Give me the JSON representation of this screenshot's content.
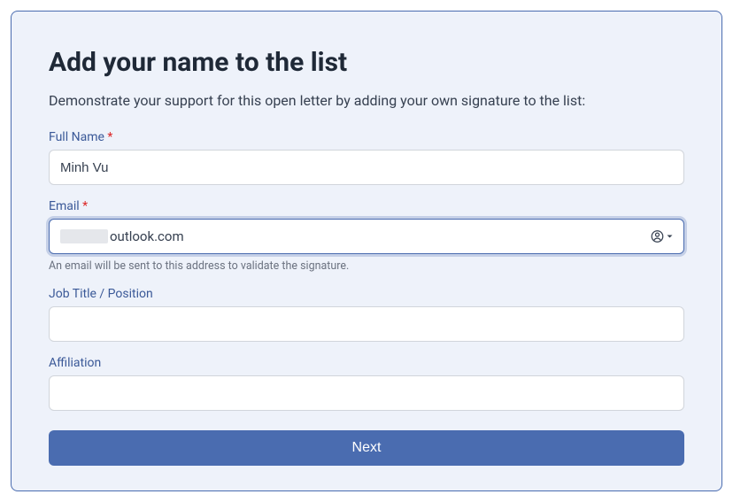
{
  "form": {
    "title": "Add your name to the list",
    "subtitle": "Demonstrate your support for this open letter by adding your own signature to the list:",
    "fields": {
      "fullName": {
        "label": "Full Name",
        "required": true,
        "value": "Minh Vu"
      },
      "email": {
        "label": "Email",
        "required": true,
        "valueSuffix": "outlook.com",
        "helper": "An email will be sent to this address to validate the signature."
      },
      "jobTitle": {
        "label": "Job Title / Position",
        "required": false,
        "value": ""
      },
      "affiliation": {
        "label": "Affiliation",
        "required": false,
        "value": ""
      }
    },
    "submitLabel": "Next",
    "requiredMark": "*"
  }
}
